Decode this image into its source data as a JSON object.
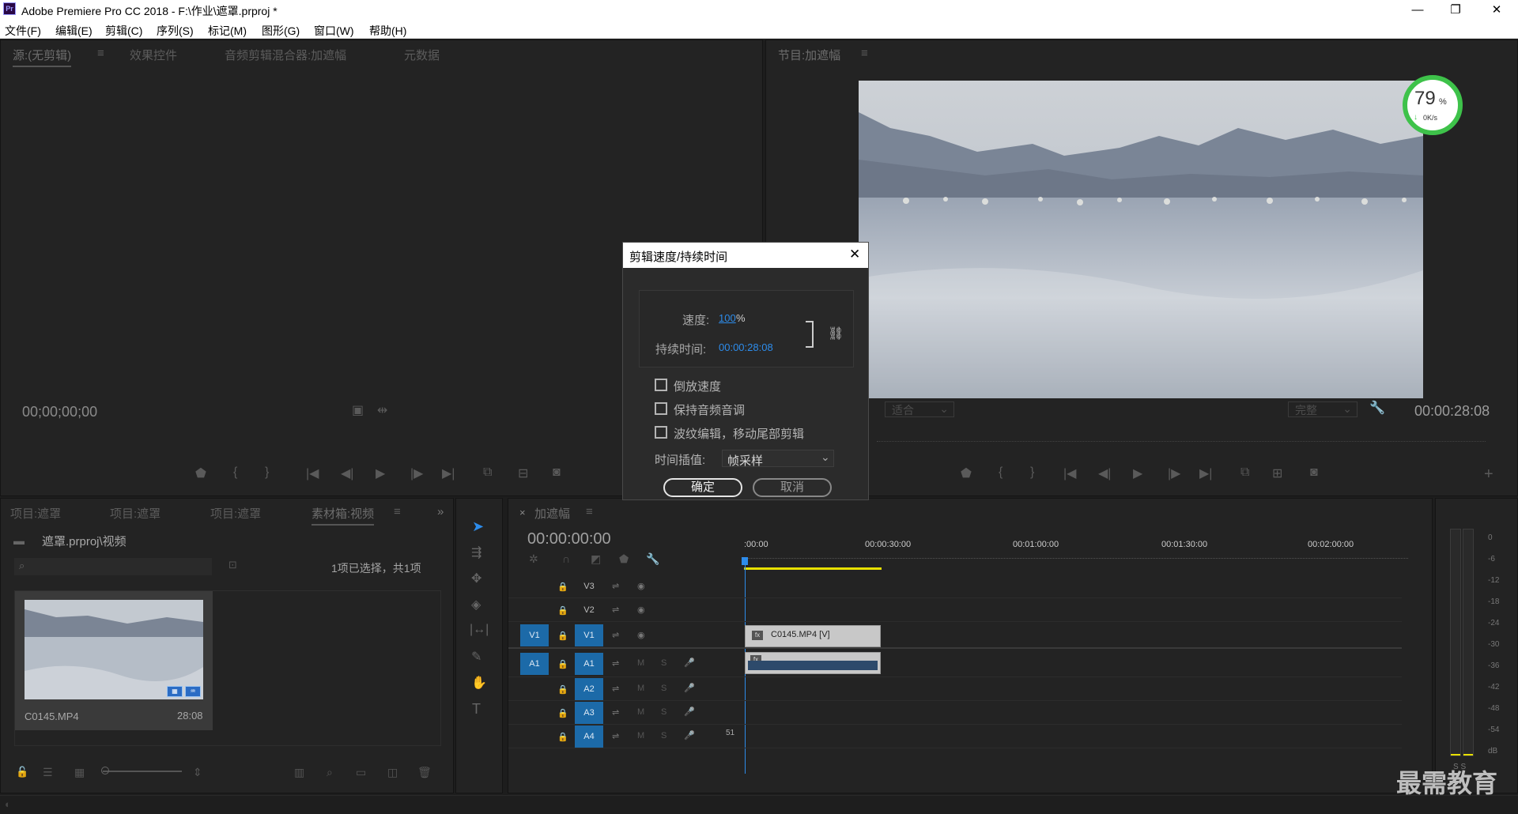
{
  "window": {
    "title": "Adobe Premiere Pro CC 2018 - F:\\作业\\遮罩.prproj *",
    "app_icon": "Pr",
    "min": "—",
    "max": "❐",
    "close": "✕"
  },
  "menu": [
    "文件(F)",
    "编辑(E)",
    "剪辑(C)",
    "序列(S)",
    "标记(M)",
    "图形(G)",
    "窗口(W)",
    "帮助(H)"
  ],
  "source_panel": {
    "tabs": [
      "源:(无剪辑)",
      "效果控件",
      "音频剪辑混合器:加遮幅",
      "元数据"
    ],
    "menu_glyph": "≡",
    "timecode": "00;00;00;00"
  },
  "program_panel": {
    "tab": "节目:加遮幅",
    "fit": "适合",
    "quality": "完整",
    "timecode": "00:00:28:08",
    "overlay": {
      "percent": "79",
      "unit": "%",
      "speed": "0K/s"
    }
  },
  "project_panel": {
    "tabs": [
      "项目:遮罩",
      "项目:遮罩",
      "项目:遮罩",
      "素材箱:视频"
    ],
    "path": "遮罩.prproj\\视频",
    "selection": "1项已选择，共1项",
    "clip": {
      "name": "C0145.MP4",
      "duration": "28:08"
    }
  },
  "timeline": {
    "tab": "加遮幅",
    "timecode": "00:00:00:00",
    "ruler": [
      ":00:00",
      "00:00:30:00",
      "00:01:00:00",
      "00:01:30:00",
      "00:02:00:00"
    ],
    "video_tracks": [
      "V3",
      "V2",
      "V1"
    ],
    "audio_tracks": [
      "A1",
      "A2",
      "A3",
      "A4"
    ],
    "v1_source": "V1",
    "a1_source": "A1",
    "clip_label": "C0145.MP4 [V]",
    "fx": "fx",
    "mute": "M",
    "solo": "S",
    "volume": "51"
  },
  "dialog": {
    "title": "剪辑速度/持续时间",
    "speed_label": "速度:",
    "speed_value": "100",
    "speed_unit": "%",
    "duration_label": "持续时间:",
    "duration_value": "00:00:28:08",
    "options": [
      "倒放速度",
      "保持音频音调",
      "波纹编辑，移动尾部剪辑"
    ],
    "interp_label": "时间插值:",
    "interp_value": "帧采样",
    "ok": "确定",
    "cancel": "取消"
  },
  "meter": {
    "scale": [
      "0",
      "-6",
      "-12",
      "-18",
      "-24",
      "-30",
      "-36",
      "-42",
      "-48",
      "-54",
      "dB"
    ],
    "footer": "S S"
  },
  "watermark": "最需教育",
  "colors": {
    "accent": "#2d8ceb",
    "track_blue": "#1c6aa8",
    "playhead": "#2d8ceb",
    "workarea": "#e8e000"
  }
}
